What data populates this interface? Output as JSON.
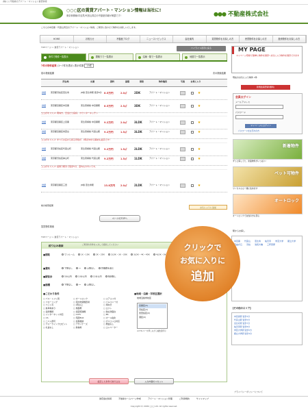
{
  "topbar": {
    "text": "(株)○○不動産のアパート・マンション賃貸情報"
  },
  "header": {
    "left_logo": "○○○",
    "title": "○○○区の賃貸アパート・マンション情報は当社に!",
    "subtitle": "東京東横線/中目黒/代官山周辺の不動産情報が満載です!",
    "company_dots": "●●●",
    "company_name": "不動産株式会社"
  },
  "intro": "こちらの中目黒・代官山周辺のアパート・マンション情報。ご希望に合わせて物件をお探しいたします。",
  "nav": [
    "HOME",
    "お知らせ",
    "不動産ブログ",
    "ニューストピックス",
    "会社案内",
    "賃貸物件をお探しの方",
    "売買物件をお探しの方",
    "投資物件をお探しの方"
  ],
  "breadcrumb": "TOPページ > 賃貸アパート・マンション",
  "hl_button": "ハイライト表示に戻る",
  "search_tabs": [
    "条件で物件一覧表示",
    "間取りで一覧表示",
    "沿線・駅で一覧表示",
    "地図で一覧表示"
  ],
  "results": {
    "count_text": "7件の物件結果",
    "range": "(1〜7件を表示)",
    "per_page_label": "表示件数",
    "per_page": "15件"
  },
  "list": {
    "prev": "前の検索結果",
    "next": "次の検索結果"
  },
  "columns": [
    "所在地",
    "交通",
    "賃料",
    "面積",
    "間取",
    "物件種別",
    "写真",
    "お気に入り"
  ],
  "rows": [
    {
      "detail": "詳細",
      "addr": "東京都渋谷区恵比寿",
      "train": "JR線 恵比寿駅 徒歩6分",
      "price": "8.5万円",
      "area": "2.0㎡",
      "plan": "2DK",
      "type": "アパート・マンション"
    },
    {
      "detail": "詳細",
      "addr": "東京都目黒区中目黒",
      "train": "東急東横線 中目黒駅",
      "price": "8.5万円",
      "area": "2.5㎡",
      "plan": "3DK",
      "type": "アパート・マンション"
    },
    {
      "detail": "詳細",
      "addr": "東京都目黒区上目黒",
      "train": "東急東横線 中目黒駅",
      "price": "9.2万円",
      "area": "2.0㎡",
      "plan": "3LDK",
      "type": "アパート・マンション"
    },
    {
      "detail": "詳細",
      "addr": "東京都目黒区青葉台",
      "train": "東急東横線 代官山駅",
      "price": "9.2万円",
      "area": "1.5㎡",
      "plan": "3LDK",
      "type": "アパート・マンション"
    },
    {
      "detail": "詳細",
      "addr": "東京都渋谷区代官山町",
      "train": "東急東横線 代官山駅",
      "price": "9.2万円",
      "area": "1.5㎡",
      "plan": "2LDK",
      "type": "アパート・マンション"
    },
    {
      "detail": "詳細",
      "addr": "東京都渋谷区鉢山町",
      "train": "東急東横線 代官山駅",
      "price": "9.2万円",
      "area": "1.5㎡",
      "plan": "1LDK",
      "type": "アパート・マンション"
    },
    {
      "detail": "詳細",
      "addr": "東京都目黒区三田",
      "train": "JR線 恵比寿駅",
      "price": "13.8万円",
      "area": "2.0㎡",
      "plan": "2LDK",
      "type": "アパート・マンション"
    }
  ],
  "notices": [
    "ココがオススメ! 南向き、日当たり良好、カウンターキッチン",
    "ココがオススメ! すべての窓から見る景色が、2階の中から眺めも最高です!",
    "ココがオススメ! 最寄り駅まで徒歩5分、室内もきれいです。"
  ],
  "fav_button": "お気に入りに追加",
  "pagetop": "ページのTOPへ",
  "search_section": {
    "title": "賃貸物件検索",
    "crumb": "TOPページ > 賃貸アパート・マンション",
    "box_title": "絞り込み検索",
    "note": "ご希望の条件を入力して検索してください",
    "labels": {
      "plan": "■間取",
      "rent": "■賃料",
      "walk": "■駅徒歩",
      "area": "■面積"
    },
    "plan_opts": [
      "ワンルーム",
      "1K・1DK",
      "2K・2DK",
      "2LDK・3K・3DK",
      "3LDK・4K・4DK",
      "4LDK・5K・5DK以上"
    ],
    "rent_opts": [
      "下限なし",
      "〜",
      "上限なし",
      "管理費を含む"
    ],
    "walk_opts": [
      "5分以内",
      "10分以内",
      "15分以内",
      "指定無し"
    ],
    "area_opts": [
      "下限なし",
      "〜",
      "上限なし"
    ],
    "kodawari_title": "■こだわり条件",
    "kodawari": [
      "バス・トイレ別",
      "オートロック",
      "エアコン付",
      "フローリング",
      "室内洗濯機置場",
      "バルコニー付",
      "ペット可",
      "2階以上",
      "南向き",
      "駐車場あり",
      "角部屋",
      "ロフト",
      "追焚機能",
      "浴室乾燥機",
      "独立洗面台",
      "インターネット対応",
      "CATV",
      "BS",
      "CS",
      "宅配BOX",
      "オール電化",
      "二人入居可",
      "楽器相談",
      "ガスコンロ対応",
      "ウォークインクロゼット",
      "デザイナーズ",
      "敷金なし",
      "礼金なし",
      "駐輪場",
      "エレベーター"
    ],
    "region_title": "■地域・沿線・学校区選択",
    "region_opts": [
      "地域",
      "沿線",
      "学校区"
    ],
    "region_list": [
      "目黒区(5)",
      "渋谷区(2)",
      "世田谷区(0)",
      "港区(0)"
    ],
    "region_note": "※CTRLキーを押しながら複数選択可",
    "search_button": "設定した条件で絞り込み",
    "reset_button": "入力内容のリセット"
  },
  "sidebar": {
    "mypage_title": "MY PAGE",
    "mypage_text": "マイページ登録で簡単に物件を保存! お気に入り物件を保存できます",
    "recent": "現在のお気に入り物件 2件",
    "mp_button": "新規会員登録(無料)",
    "login_title": "会員ログイン",
    "mail_label": "メールアドレス",
    "pass_label": "パスワード",
    "login_button": "マイページにログイン",
    "forgot": "パスワードをお忘れの方",
    "banners": [
      {
        "text": "新着物件",
        "caption": "ずっと探してた、新築物件がいっぱい!"
      },
      {
        "text": "ペット可物件",
        "caption": "ワンちゃんも一緒に住めます"
      },
      {
        "text": "オートロック",
        "caption": "オートロックで女性の方も安心"
      }
    ],
    "area_title": "駅からお探し",
    "areas": [
      "中目黒",
      "代官山",
      "恵比寿",
      "祐天寺",
      "学芸大学",
      "都立大学",
      "自由が丘",
      "渋谷",
      "池尻大橋",
      "三軒茶屋"
    ],
    "eki_title": "【その他のエリア】",
    "eki": [
      "中目黒駅 徒歩3分",
      "代官山駅 徒歩5分",
      "恵比寿駅 徒歩7分",
      "祐天寺駅 徒歩8分",
      "学芸大学駅 徒歩5分",
      "都立大学駅 徒歩4分"
    ]
  },
  "promo": {
    "l1": "クリックで",
    "l2": "お気に入りに",
    "l3": "追加"
  },
  "privacy": "プライバシーポリシーについて",
  "footer_links": [
    "賃貸会社情報",
    "不動産ホームページ作成",
    "アパート・マンション管理",
    "ご利用規約",
    "サイトマップ"
  ],
  "copyright": "Copyright (C) 2009 ○○○ Ltd. All rights reserved."
}
